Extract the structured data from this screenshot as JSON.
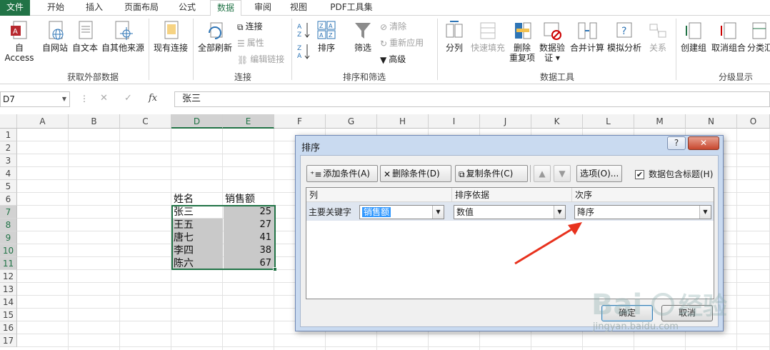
{
  "tabs": [
    "文件",
    "开始",
    "插入",
    "页面布局",
    "公式",
    "数据",
    "审阅",
    "视图",
    "PDF工具集"
  ],
  "ribbon": {
    "get_external": {
      "buttons": [
        "自 Access",
        "自网站",
        "自文本",
        "自其他来源",
        "现有连接"
      ],
      "label": "获取外部数据"
    },
    "connections": {
      "refresh_all": "全部刷新",
      "small": [
        "连接",
        "属性",
        "编辑链接"
      ],
      "label": "连接"
    },
    "sort_filter": {
      "sort": "排序",
      "filter": "筛选",
      "small": [
        "清除",
        "重新应用",
        "高级"
      ],
      "label": "排序和筛选"
    },
    "data_tools": {
      "buttons": [
        "分列",
        "快速填充",
        "删除",
        "重复项",
        "数据验",
        "证 ▾",
        "合并计算",
        "模拟分析",
        "关系"
      ],
      "label": "数据工具"
    },
    "outline": {
      "buttons": [
        "创建组",
        "取消组合",
        "分类汇"
      ],
      "label": "分级显示"
    }
  },
  "formula_bar": {
    "name_box": "D7",
    "formula": "张三"
  },
  "sheet": {
    "columns": [
      "A",
      "B",
      "C",
      "D",
      "E",
      "F",
      "G",
      "H",
      "I",
      "J",
      "K",
      "L",
      "M",
      "N",
      "O"
    ],
    "rows": [
      "1",
      "2",
      "3",
      "4",
      "5",
      "6",
      "7",
      "8",
      "9",
      "10",
      "11",
      "12",
      "13",
      "14",
      "15",
      "16",
      "17"
    ],
    "header_row": {
      "name": "姓名",
      "sales": "销售额"
    },
    "data": [
      {
        "name": "张三",
        "sales": "25"
      },
      {
        "name": "王五",
        "sales": "27"
      },
      {
        "name": "唐七",
        "sales": "41"
      },
      {
        "name": "李四",
        "sales": "38"
      },
      {
        "name": "陈六",
        "sales": "67"
      }
    ]
  },
  "dialog": {
    "title": "排序",
    "help": "?",
    "buttons": {
      "add": "添加条件(A)",
      "delete": "删除条件(D)",
      "copy": "复制条件(C)",
      "options": "选项(O)..."
    },
    "header_checkbox": {
      "label": "数据包含标题(H)",
      "checked": "✔"
    },
    "list_headers": {
      "column": "列",
      "sort_on": "排序依据",
      "order": "次序"
    },
    "row": {
      "key_label": "主要关键字",
      "column_value": "销售额",
      "sort_on_value": "数值",
      "order_value": "降序"
    },
    "ok": "确定",
    "cancel": "取消"
  },
  "watermark": {
    "brand": "Bai 经验",
    "url": "jingyan.baidu.com"
  },
  "colors": {
    "excel_green": "#217346",
    "arrow_red": "#e8321e"
  }
}
